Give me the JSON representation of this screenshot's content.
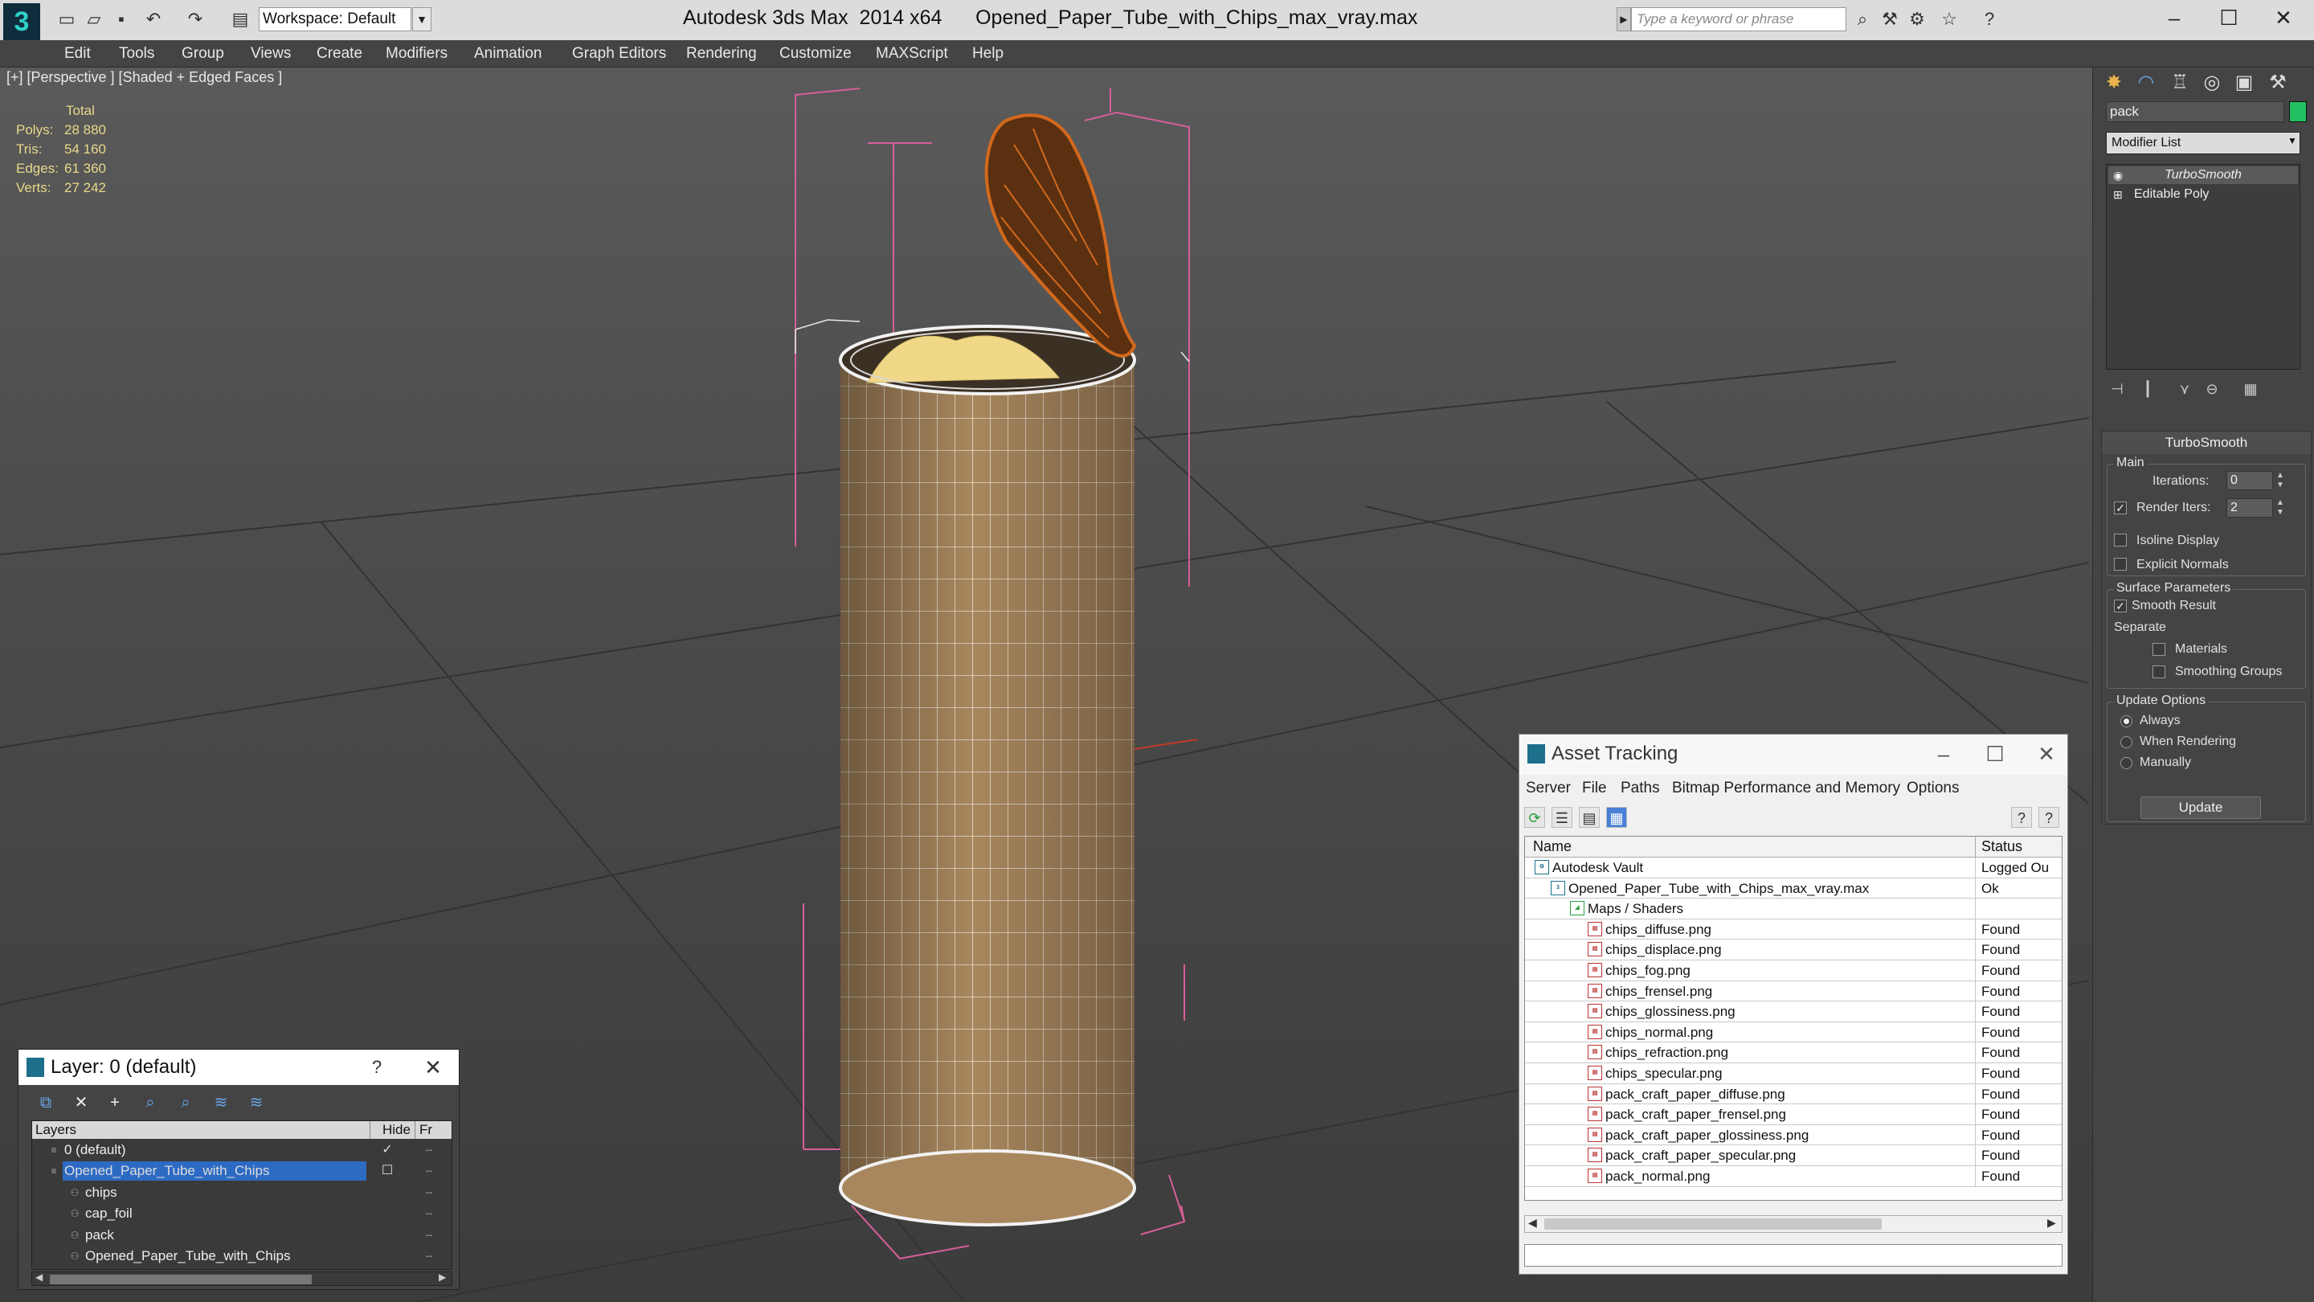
{
  "titlebar": {
    "workspace": "Workspace: Default",
    "app_title": "Autodesk 3ds Max  2014 x64      Opened_Paper_Tube_with_Chips_max_vray.max",
    "search_placeholder": "Type a keyword or phrase",
    "logo_glyph": "3"
  },
  "menu": [
    "Edit",
    "Tools",
    "Group",
    "Views",
    "Create",
    "Modifiers",
    "Animation",
    "Graph Editors",
    "Rendering",
    "Customize",
    "MAXScript",
    "Help"
  ],
  "viewport": {
    "label": "[+] [Perspective ] [Shaded + Edged Faces ]",
    "stats": {
      "header": "Total",
      "rows": [
        {
          "key": "Polys:",
          "value": "28 880"
        },
        {
          "key": "Tris:",
          "value": "54 160"
        },
        {
          "key": "Edges:",
          "value": "61 360"
        },
        {
          "key": "Verts:",
          "value": "27 242"
        }
      ]
    }
  },
  "command_panel": {
    "object_name": "pack",
    "modifier_list": "Modifier List",
    "stack": [
      "TurboSmooth",
      "Editable Poly"
    ],
    "turbosmooth": {
      "title": "TurboSmooth",
      "main_label": "Main",
      "iterations_label": "Iterations:",
      "iterations_value": "0",
      "render_iters_label": "Render Iters:",
      "render_iters_value": "2",
      "isoline_label": "Isoline Display",
      "explicit_normals_label": "Explicit Normals",
      "surface_params_label": "Surface Parameters",
      "smooth_result_label": "Smooth Result",
      "separate_label": "Separate",
      "materials_label": "Materials",
      "smoothing_groups_label": "Smoothing Groups",
      "update_options_label": "Update Options",
      "always_label": "Always",
      "when_rendering_label": "When Rendering",
      "manually_label": "Manually",
      "update_button": "Update"
    }
  },
  "asset_tracking": {
    "title": "Asset Tracking",
    "menu": [
      "Server",
      "File",
      "Paths",
      "Bitmap Performance and Memory",
      "Options"
    ],
    "columns": {
      "name": "Name",
      "status": "Status"
    },
    "rows": [
      {
        "name": "Autodesk Vault",
        "status": "Logged Ou",
        "indent": 0,
        "icon": "vault"
      },
      {
        "name": "Opened_Paper_Tube_with_Chips_max_vray.max",
        "status": "Ok",
        "indent": 1,
        "icon": "max"
      },
      {
        "name": "Maps / Shaders",
        "status": "",
        "indent": 2,
        "icon": "maps"
      },
      {
        "name": "chips_diffuse.png",
        "status": "Found",
        "indent": 3,
        "icon": "png"
      },
      {
        "name": "chips_displace.png",
        "status": "Found",
        "indent": 3,
        "icon": "png"
      },
      {
        "name": "chips_fog.png",
        "status": "Found",
        "indent": 3,
        "icon": "png"
      },
      {
        "name": "chips_frensel.png",
        "status": "Found",
        "indent": 3,
        "icon": "png"
      },
      {
        "name": "chips_glossiness.png",
        "status": "Found",
        "indent": 3,
        "icon": "png"
      },
      {
        "name": "chips_normal.png",
        "status": "Found",
        "indent": 3,
        "icon": "png"
      },
      {
        "name": "chips_refraction.png",
        "status": "Found",
        "indent": 3,
        "icon": "png"
      },
      {
        "name": "chips_specular.png",
        "status": "Found",
        "indent": 3,
        "icon": "png"
      },
      {
        "name": "pack_craft_paper_diffuse.png",
        "status": "Found",
        "indent": 3,
        "icon": "png"
      },
      {
        "name": "pack_craft_paper_frensel.png",
        "status": "Found",
        "indent": 3,
        "icon": "png"
      },
      {
        "name": "pack_craft_paper_glossiness.png",
        "status": "Found",
        "indent": 3,
        "icon": "png"
      },
      {
        "name": "pack_craft_paper_specular.png",
        "status": "Found",
        "indent": 3,
        "icon": "png"
      },
      {
        "name": "pack_normal.png",
        "status": "Found",
        "indent": 3,
        "icon": "png"
      }
    ]
  },
  "layer_dialog": {
    "title": "Layer: 0 (default)",
    "help": "?",
    "columns": {
      "layers": "Layers",
      "hide": "Hide",
      "freeze": "Fr"
    },
    "rows": [
      {
        "name": "0 (default)",
        "indent": 0,
        "selected": false,
        "current": true
      },
      {
        "name": "Opened_Paper_Tube_with_Chips",
        "indent": 0,
        "selected": true,
        "current": false
      },
      {
        "name": "chips",
        "indent": 1,
        "selected": false,
        "current": false
      },
      {
        "name": "cap_foil",
        "indent": 1,
        "selected": false,
        "current": false
      },
      {
        "name": "pack",
        "indent": 1,
        "selected": false,
        "current": false
      },
      {
        "name": "Opened_Paper_Tube_with_Chips",
        "indent": 1,
        "selected": false,
        "current": false
      }
    ]
  },
  "colors": {
    "viewport_bg": "#4a4a4a",
    "selection_blue": "#2d6ac4",
    "stats_yellow": "#e8d98a",
    "object_color": "#22c060",
    "tube_brown": "#a9875e"
  }
}
